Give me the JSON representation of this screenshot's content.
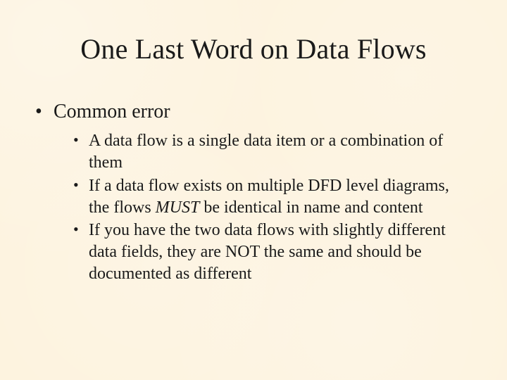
{
  "title": "One Last Word on Data Flows",
  "bullets": {
    "l1": {
      "a": "Common error"
    },
    "l2": {
      "a": "A data flow is a single data item or a combination of them",
      "b_prefix": "If a data flow exists on multiple DFD level diagrams, the flows ",
      "b_must": "MUST",
      "b_suffix": " be identical in name and content",
      "c": "If you have the two data flows with slightly different data fields, they are NOT the same and should be documented as different"
    }
  }
}
